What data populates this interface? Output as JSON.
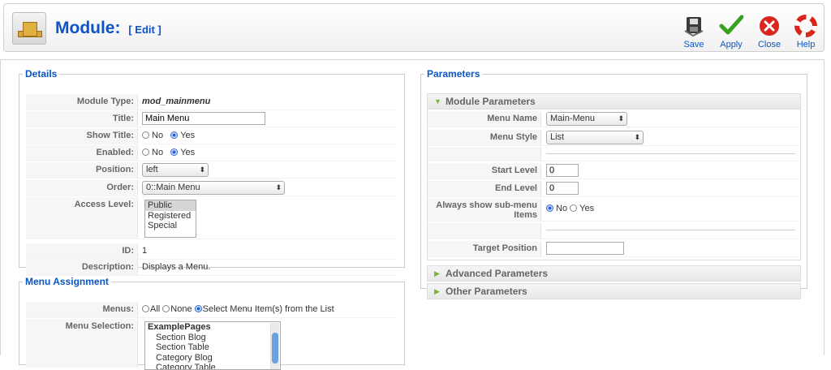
{
  "header": {
    "title": "Module:",
    "subtitle": "[ Edit ]"
  },
  "toolbar": {
    "save_label": "Save",
    "apply_label": "Apply",
    "close_label": "Close",
    "help_label": "Help"
  },
  "details": {
    "legend": "Details",
    "module_type_label": "Module Type:",
    "module_type_value": "mod_mainmenu",
    "title_label": "Title:",
    "title_value": "Main Menu",
    "show_title_label": "Show Title:",
    "no_label": "No",
    "yes_label": "Yes",
    "enabled_label": "Enabled:",
    "position_label": "Position:",
    "position_value": "left",
    "order_label": "Order:",
    "order_value": "0::Main Menu",
    "access_label": "Access Level:",
    "access_options": [
      "Public",
      "Registered",
      "Special"
    ],
    "id_label": "ID:",
    "id_value": "1",
    "description_label": "Description:",
    "description_value": "Displays a Menu."
  },
  "menu_assignment": {
    "legend": "Menu Assignment",
    "menus_label": "Menus:",
    "opt_all": "All",
    "opt_none": "None",
    "opt_select": "Select Menu Item(s) from the List",
    "selection_label": "Menu Selection:",
    "items": [
      "ExamplePages",
      "Section Blog",
      "Section Table",
      "Category Blog",
      "Category Table"
    ]
  },
  "parameters": {
    "legend": "Parameters",
    "module_params_head": "Module Parameters",
    "menu_name_label": "Menu Name",
    "menu_name_value": "Main-Menu",
    "menu_style_label": "Menu Style",
    "menu_style_value": "List",
    "start_level_label": "Start Level",
    "start_level_value": "0",
    "end_level_label": "End Level",
    "end_level_value": "0",
    "always_show_label": "Always show sub-menu Items",
    "no_label": "No",
    "yes_label": "Yes",
    "target_position_label": "Target Position",
    "target_position_value": "",
    "advanced_head": "Advanced Parameters",
    "other_head": "Other Parameters"
  },
  "colors": {
    "accent": "#0b55c4",
    "pane_triangle": "#7ab433"
  }
}
